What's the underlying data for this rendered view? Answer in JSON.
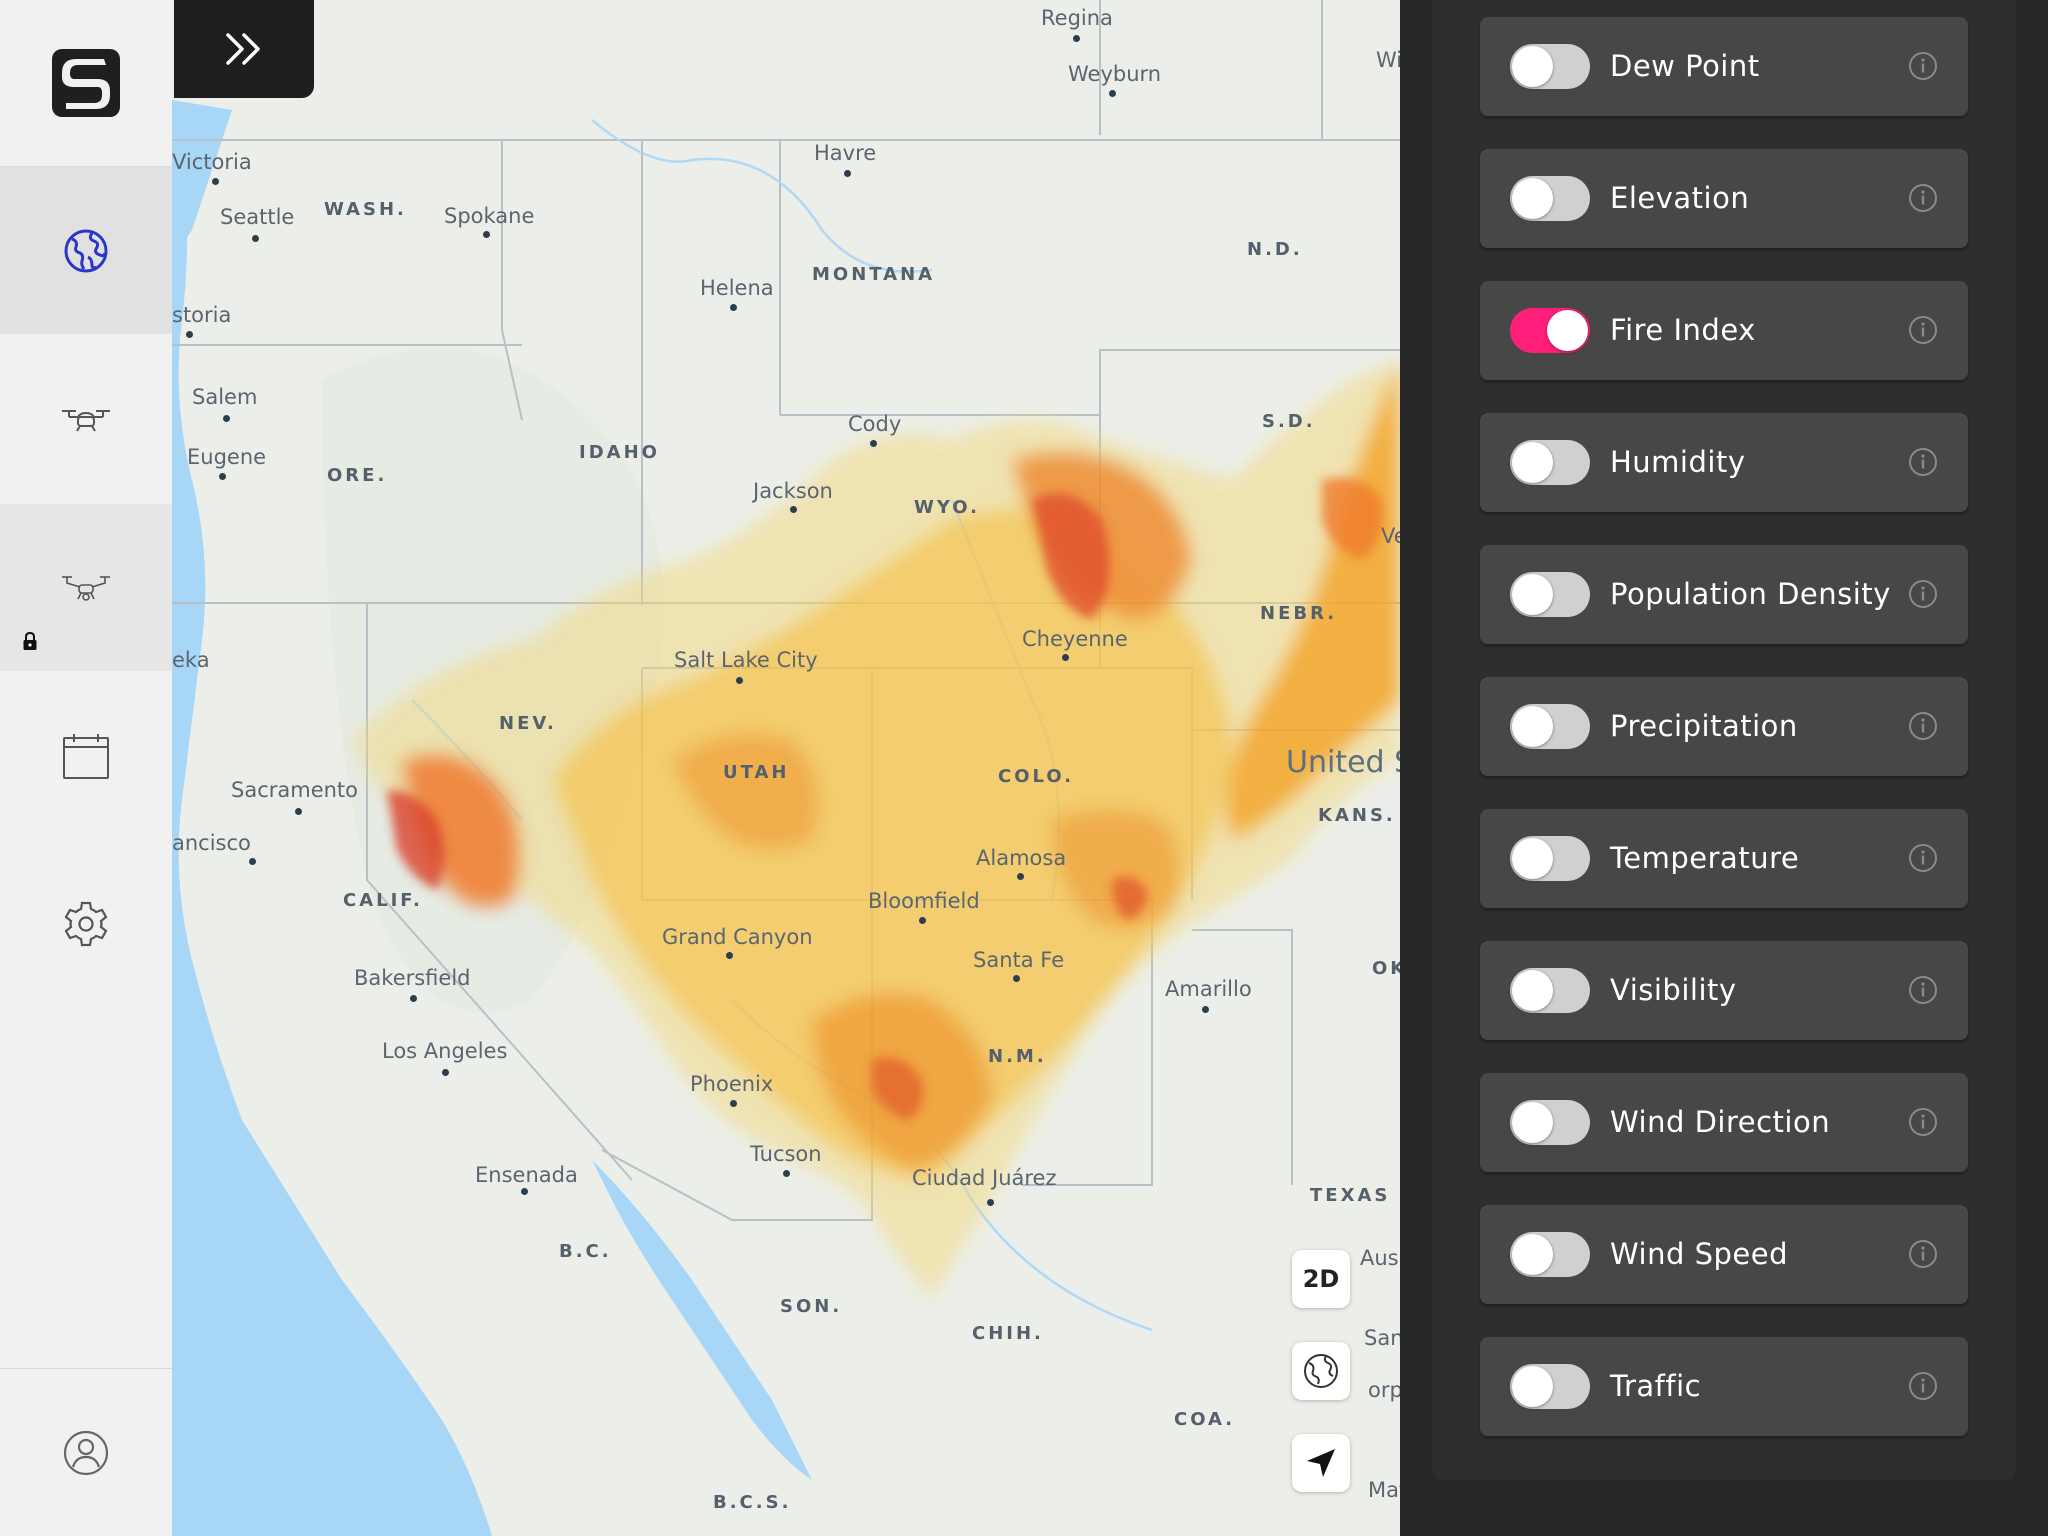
{
  "nav": {
    "items": [
      {
        "id": "logo",
        "icon": "app-logo-icon"
      },
      {
        "id": "map",
        "icon": "globe-icon",
        "selected": true
      },
      {
        "id": "drone",
        "icon": "drone-icon"
      },
      {
        "id": "fleet",
        "icon": "drone-fleet-icon",
        "locked": true
      },
      {
        "id": "schedule",
        "icon": "calendar-icon"
      },
      {
        "id": "settings",
        "icon": "gear-icon"
      },
      {
        "id": "account",
        "icon": "user-icon"
      }
    ],
    "accent": "#2a36c9"
  },
  "map": {
    "places": {
      "regina": "Regina",
      "weyburn": "Weyburn",
      "havre": "Havre",
      "victoria": "Victoria",
      "seattle": "Seattle",
      "spokane": "Spokane",
      "helena": "Helena",
      "storia": "storia",
      "salem": "Salem",
      "eugene": "Eugene",
      "cody": "Cody",
      "jackson": "Jackson",
      "cheyenne": "Cheyenne",
      "salt_lake_city": "Salt Lake City",
      "eka": "eka",
      "sacramento": "Sacramento",
      "ancisco": "ancisco",
      "alamosa": "Alamosa",
      "bloomfield": "Bloomfield",
      "grand_canyon": "Grand Canyon",
      "santa_fe": "Santa Fe",
      "amarillo": "Amarillo",
      "bakersfield": "Bakersfield",
      "los_angeles": "Los Angeles",
      "phoenix": "Phoenix",
      "tucson": "Tucson",
      "ciudad_juarez": "Ciudad Juárez",
      "ensenada": "Ensenada",
      "aus": "Aus",
      "san": "San",
      "orpu": "orpu",
      "mata": "Mata",
      "wi": "Wi",
      "ve": "Ve"
    },
    "regions": {
      "wash": "WASH.",
      "montana": "MONTANA",
      "nd": "N.D.",
      "sd": "S.D.",
      "idaho": "IDAHO",
      "ore": "ORE.",
      "wyo": "WYO.",
      "nebr": "NEBR.",
      "nev": "NEV.",
      "utah": "UTAH",
      "colo": "COLO.",
      "kans": "KANS.",
      "calif": "CALIF.",
      "ok": "OK",
      "nm": "N.M.",
      "texas": "TEXAS",
      "bc": "B.C.",
      "son": "SON.",
      "chih": "CHIH.",
      "coa": "COA.",
      "bcs": "B.C.S."
    },
    "country": "United S",
    "controls": {
      "view_mode": "2D",
      "globe_icon": "globe-icon",
      "locate_icon": "navigation-arrow-icon"
    },
    "expand_icon": "double-chevron-right-icon"
  },
  "layers": {
    "items": [
      {
        "label": "Dew Point",
        "enabled": false
      },
      {
        "label": "Elevation",
        "enabled": false
      },
      {
        "label": "Fire Index",
        "enabled": true
      },
      {
        "label": "Humidity",
        "enabled": false
      },
      {
        "label": "Population Density",
        "enabled": false
      },
      {
        "label": "Precipitation",
        "enabled": false
      },
      {
        "label": "Temperature",
        "enabled": false
      },
      {
        "label": "Visibility",
        "enabled": false
      },
      {
        "label": "Wind Direction",
        "enabled": false
      },
      {
        "label": "Wind Speed",
        "enabled": false
      },
      {
        "label": "Traffic",
        "enabled": false
      }
    ],
    "toggle_on_color": "#ff1f7a",
    "info_icon": "info-icon"
  }
}
